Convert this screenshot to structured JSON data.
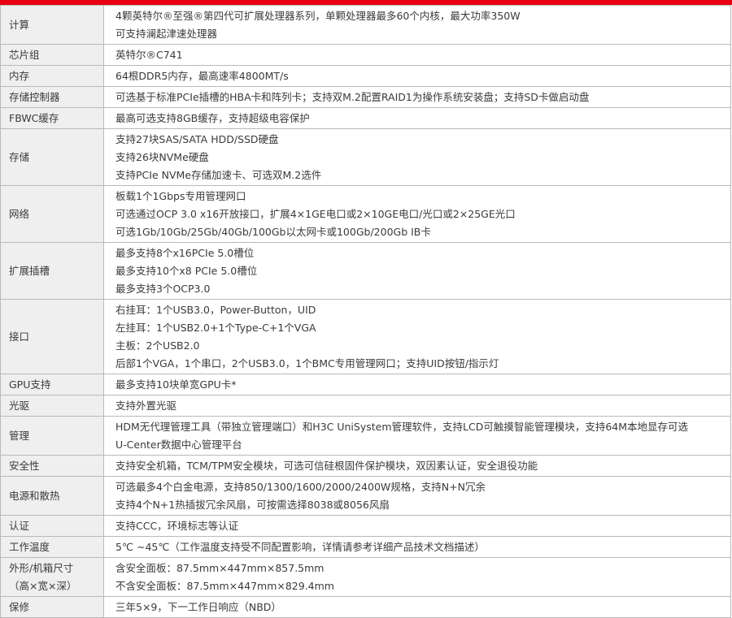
{
  "colors": {
    "accent_red": "#e60012",
    "label_bg": "#efefef",
    "border": "#b9b9b9",
    "text": "#3a3a3a"
  },
  "rows": [
    {
      "label": [
        "计算"
      ],
      "lines": [
        "4颗英特尔®至强®第四代可扩展处理器系列，单颗处理器最多60个内核，最大功率350W",
        "可支持澜起津速处理器"
      ]
    },
    {
      "label": [
        "芯片组"
      ],
      "lines": [
        "英特尔®C741"
      ]
    },
    {
      "label": [
        "内存"
      ],
      "lines": [
        "64根DDR5内存，最高速率4800MT/s"
      ]
    },
    {
      "label": [
        "存储控制器"
      ],
      "lines": [
        "可选基于标准PCIe插槽的HBA卡和阵列卡；支持双M.2配置RAID1为操作系统安装盘；支持SD卡做启动盘"
      ]
    },
    {
      "label": [
        "FBWC缓存"
      ],
      "lines": [
        "最高可选支持8GB缓存，支持超级电容保护"
      ]
    },
    {
      "label": [
        "存储"
      ],
      "lines": [
        "支持27块SAS/SATA HDD/SSD硬盘",
        "支持26块NVMe硬盘",
        "支持PCIe NVMe存储加速卡、可选双M.2选件"
      ]
    },
    {
      "label": [
        "网络"
      ],
      "lines": [
        "板载1个1Gbps专用管理网口",
        "可选通过OCP 3.0 x16开放接口，扩展4×1GE电口或2×10GE电口/光口或2×25GE光口",
        "可选1Gb/10Gb/25Gb/40Gb/100Gb以太网卡或100Gb/200Gb IB卡"
      ]
    },
    {
      "label": [
        "扩展插槽"
      ],
      "lines": [
        "最多支持8个x16PCIe 5.0槽位",
        "最多支持10个x8 PCIe 5.0槽位",
        "最多支持3个OCP3.0"
      ]
    },
    {
      "label": [
        "接口"
      ],
      "lines": [
        "右挂耳：1个USB3.0，Power-Button，UID",
        "左挂耳：1个USB2.0+1个Type-C+1个VGA",
        "主板：2个USB2.0",
        "后部1个VGA，1个串口，2个USB3.0，1个BMC专用管理网口；支持UID按钮/指示灯"
      ]
    },
    {
      "label": [
        "GPU支持"
      ],
      "lines": [
        "最多支持10块单宽GPU卡*"
      ]
    },
    {
      "label": [
        "光驱"
      ],
      "lines": [
        "支持外置光驱"
      ]
    },
    {
      "label": [
        "管理"
      ],
      "lines": [
        "HDM无代理管理工具（带独立管理端口）和H3C UniSystem管理软件，支持LCD可触摸智能管理模块，支持64M本地显存可选",
        "U-Center数据中心管理平台"
      ]
    },
    {
      "label": [
        "安全性"
      ],
      "lines": [
        "支持安全机箱，TCM/TPM安全模块，可选可信硅根固件保护模块，双因素认证，安全退役功能"
      ]
    },
    {
      "label": [
        "电源和散热"
      ],
      "lines": [
        "可选最多4个白金电源，支持850/1300/1600/2000/2400W规格，支持N+N冗余",
        "支持4个N+1热插拔冗余风扇，可按需选择8038或8056风扇"
      ]
    },
    {
      "label": [
        "认证"
      ],
      "lines": [
        "支持CCC，环境标志等认证"
      ]
    },
    {
      "label": [
        "工作温度"
      ],
      "lines": [
        "5℃ ~45℃（工作温度支持受不同配置影响，详情请参考详细产品技术文档描述）"
      ]
    },
    {
      "label": [
        "外形/机箱尺寸",
        "（高×宽×深）"
      ],
      "lines": [
        "含安全面板：87.5mm×447mm×857.5mm",
        "不含安全面板：87.5mm×447mm×829.4mm"
      ]
    },
    {
      "label": [
        "保修"
      ],
      "lines": [
        "三年5×9，下一工作日响应（NBD）"
      ]
    }
  ]
}
